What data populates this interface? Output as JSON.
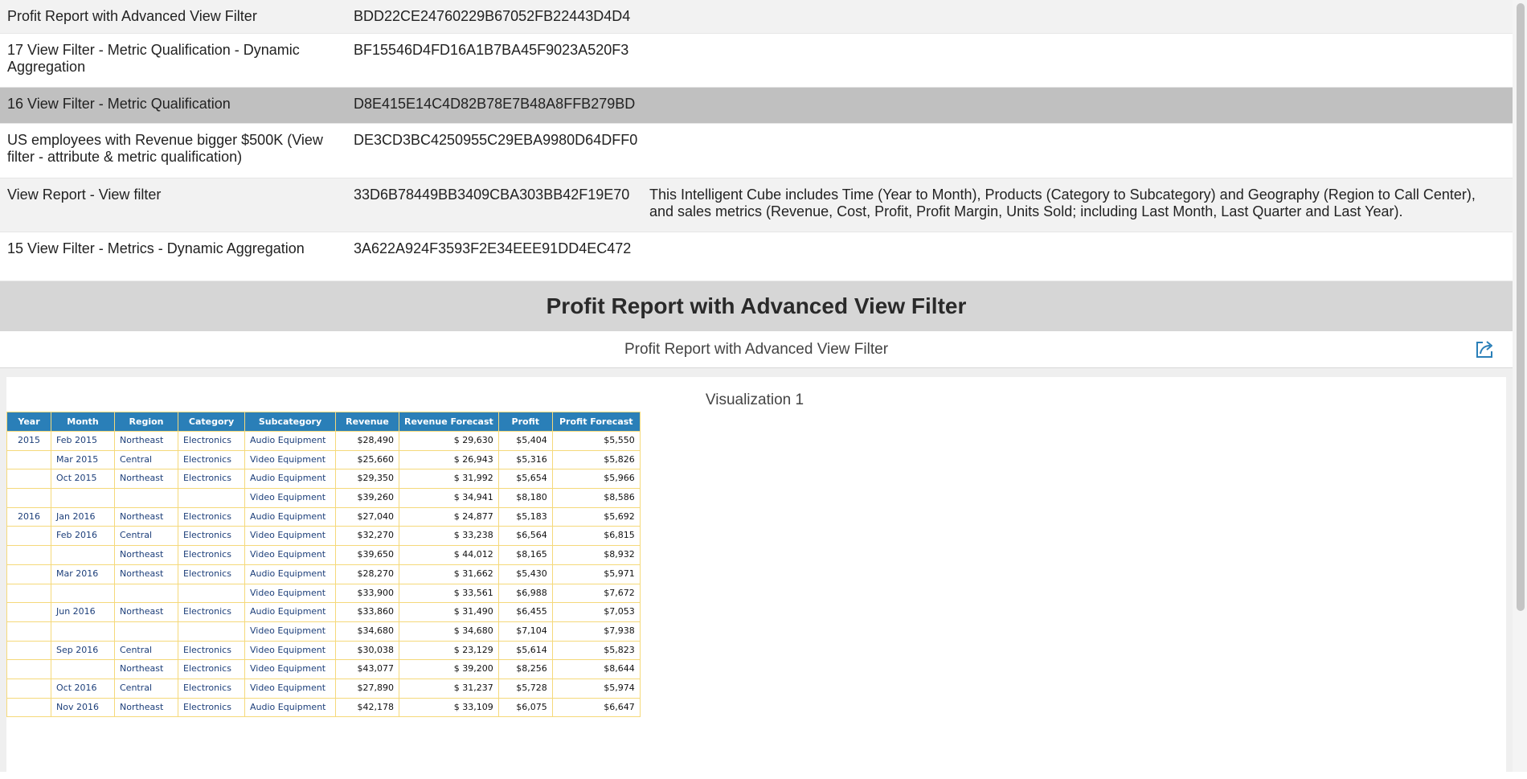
{
  "reports": [
    {
      "name": "Profit Report with Advanced View Filter",
      "id": "BDD22CE24760229B67052FB22443D4D4",
      "description": ""
    },
    {
      "name": "17 View Filter - Metric Qualification - Dynamic Aggregation",
      "id": "BF15546D4FD16A1B7BA45F9023A520F3",
      "description": ""
    },
    {
      "name": "16 View Filter - Metric Qualification",
      "id": "D8E415E14C4D82B78E7B48A8FFB279BD",
      "description": ""
    },
    {
      "name": "US employees with Revenue bigger $500K (View filter - attribute & metric qualification)",
      "id": "DE3CD3BC4250955C29EBA9980D64DFF0",
      "description": ""
    },
    {
      "name": "View Report - View filter",
      "id": "33D6B78449BB3409CBA303BB42F19E70",
      "description": "This Intelligent Cube includes Time (Year to Month), Products (Category to Subcategory) and Geography (Region to Call Center), and sales metrics (Revenue, Cost, Profit, Profit Margin, Units Sold; including Last Month, Last Quarter and Last Year)."
    },
    {
      "name": "15 View Filter - Metrics - Dynamic Aggregation",
      "id": "3A622A924F3593F2E34EEE91DD4EC472",
      "description": ""
    }
  ],
  "section_title": "Profit Report with Advanced View Filter",
  "dossier_title": "Profit Report with Advanced View Filter",
  "share_icon": "share-export-icon",
  "visualization_title": "Visualization 1",
  "colors": {
    "header_bg": "#2a7fb8",
    "grid_border": "#f5d97a",
    "selected_row": "#c0c0c0",
    "section_bg": "#d6d6d6"
  },
  "grid": {
    "columns": [
      "Year",
      "Month",
      "Region",
      "Category",
      "Subcategory",
      "Revenue",
      "Revenue Forecast",
      "Profit",
      "Profit Forecast"
    ],
    "rows": [
      [
        "2015",
        "Feb 2015",
        "Northeast",
        "Electronics",
        "Audio Equipment",
        "$28,490",
        "$ 29,630",
        "$5,404",
        "$5,550"
      ],
      [
        "",
        "Mar 2015",
        "Central",
        "Electronics",
        "Video Equipment",
        "$25,660",
        "$ 26,943",
        "$5,316",
        "$5,826"
      ],
      [
        "",
        "Oct 2015",
        "Northeast",
        "Electronics",
        "Audio Equipment",
        "$29,350",
        "$ 31,992",
        "$5,654",
        "$5,966"
      ],
      [
        "",
        "",
        "",
        "",
        "Video Equipment",
        "$39,260",
        "$ 34,941",
        "$8,180",
        "$8,586"
      ],
      [
        "2016",
        "Jan 2016",
        "Northeast",
        "Electronics",
        "Audio Equipment",
        "$27,040",
        "$ 24,877",
        "$5,183",
        "$5,692"
      ],
      [
        "",
        "Feb 2016",
        "Central",
        "Electronics",
        "Video Equipment",
        "$32,270",
        "$ 33,238",
        "$6,564",
        "$6,815"
      ],
      [
        "",
        "",
        "Northeast",
        "Electronics",
        "Video Equipment",
        "$39,650",
        "$ 44,012",
        "$8,165",
        "$8,932"
      ],
      [
        "",
        "Mar 2016",
        "Northeast",
        "Electronics",
        "Audio Equipment",
        "$28,270",
        "$ 31,662",
        "$5,430",
        "$5,971"
      ],
      [
        "",
        "",
        "",
        "",
        "Video Equipment",
        "$33,900",
        "$ 33,561",
        "$6,988",
        "$7,672"
      ],
      [
        "",
        "Jun 2016",
        "Northeast",
        "Electronics",
        "Audio Equipment",
        "$33,860",
        "$ 31,490",
        "$6,455",
        "$7,053"
      ],
      [
        "",
        "",
        "",
        "",
        "Video Equipment",
        "$34,680",
        "$ 34,680",
        "$7,104",
        "$7,938"
      ],
      [
        "",
        "Sep 2016",
        "Central",
        "Electronics",
        "Video Equipment",
        "$30,038",
        "$ 23,129",
        "$5,614",
        "$5,823"
      ],
      [
        "",
        "",
        "Northeast",
        "Electronics",
        "Video Equipment",
        "$43,077",
        "$ 39,200",
        "$8,256",
        "$8,644"
      ],
      [
        "",
        "Oct 2016",
        "Central",
        "Electronics",
        "Video Equipment",
        "$27,890",
        "$ 31,237",
        "$5,728",
        "$5,974"
      ],
      [
        "",
        "Nov 2016",
        "Northeast",
        "Electronics",
        "Audio Equipment",
        "$42,178",
        "$ 33,109",
        "$6,075",
        "$6,647"
      ]
    ]
  }
}
